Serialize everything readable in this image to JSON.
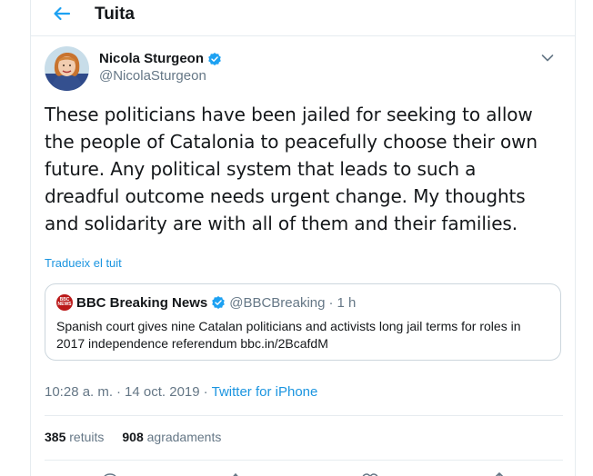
{
  "header": {
    "title": "Tuita",
    "back_icon": "arrow-left-icon"
  },
  "author": {
    "display_name": "Nicola Sturgeon",
    "handle": "@NicolaSturgeon",
    "verified_icon": "verified-badge-icon",
    "menu_icon": "chevron-down-icon"
  },
  "tweet": {
    "lines": [
      "These politicians have been jailed for seeking to allow",
      "the people of Catalonia to peacefully choose their own",
      "future. Any political system that leads to such a",
      "dreadful outcome needs urgent change. My thoughts",
      "and solidarity are with all of them and their families."
    ],
    "translate_label": "Tradueix el tuit"
  },
  "quote": {
    "logo_text": [
      "BBC",
      "NEWS"
    ],
    "display_name": "BBC Breaking News",
    "handle": "@BBCBreaking",
    "separator": "·",
    "time": "1 h",
    "text_lines": [
      "Spanish court gives nine Catalan politicians and activists long jail terms for roles in",
      "2017 independence referendum bbc.in/2BcafdM"
    ]
  },
  "meta": {
    "time": "10:28 a. m.",
    "separator1": "·",
    "date": "14 oct. 2019",
    "separator2": "·",
    "source": "Twitter for iPhone"
  },
  "stats": {
    "retweets_count": "385",
    "retweets_label": "retuits",
    "likes_count": "908",
    "likes_label": "agradaments"
  },
  "actions": [
    "reply-icon",
    "retweet-icon",
    "like-icon",
    "share-icon"
  ],
  "colors": {
    "accent": "#1da1f2",
    "link": "#1b95e0",
    "secondary_text": "#657786",
    "border": "#e6ecf0",
    "bbc_red": "#bb1919"
  }
}
